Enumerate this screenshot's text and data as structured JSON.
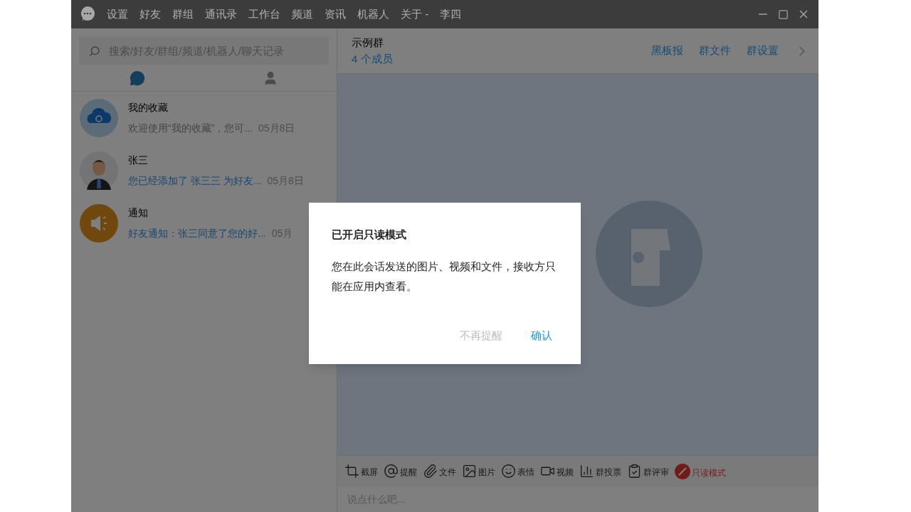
{
  "menu": [
    "设置",
    "好友",
    "群组",
    "通讯录",
    "工作台",
    "频道",
    "资讯",
    "机器人",
    "关于 -"
  ],
  "user": "李四",
  "search": {
    "placeholder": "搜索/好友/群组/频道/机器人/聊天记录"
  },
  "tabs": [
    {
      "kind": "chat",
      "selected": true
    },
    {
      "kind": "contacts",
      "selected": false
    }
  ],
  "conversations": [
    {
      "kind": "cloud",
      "name": "我的收藏",
      "preview": "欢迎使用“我的收藏”，您可...",
      "date": "05月8日",
      "highlighted": false
    },
    {
      "kind": "person",
      "name": "张三",
      "preview": "您已经添加了 张三三  为好友...",
      "date": "05月8日",
      "highlighted": true
    },
    {
      "kind": "speaker",
      "name": "通知",
      "preview": "好友通知：张三同意了您的好...",
      "date": "05月",
      "highlighted": true
    }
  ],
  "chat": {
    "title": "示例群",
    "members": "4 个成员",
    "actions": [
      "黑板报",
      "群文件",
      "群设置"
    ]
  },
  "toolbar": [
    {
      "kind": "crop",
      "label": "截屏",
      "active": false
    },
    {
      "kind": "at",
      "label": "提醒",
      "active": false
    },
    {
      "kind": "clip",
      "label": "文件",
      "active": false
    },
    {
      "kind": "image",
      "label": "图片",
      "active": false
    },
    {
      "kind": "smile",
      "label": "表情",
      "active": false
    },
    {
      "kind": "video",
      "label": "视频",
      "active": false
    },
    {
      "kind": "chart",
      "label": "群投票",
      "active": false
    },
    {
      "kind": "review",
      "label": "群评审",
      "active": false
    },
    {
      "kind": "readonly",
      "label": "只读模式",
      "active": true
    }
  ],
  "input": {
    "placeholder": "说点什么吧..."
  },
  "dialog": {
    "title": "已开启只读模式",
    "message": "您在此会话发送的图片、视频和文件，接收方只能在应用内查看。",
    "buttons": [
      {
        "kind": "secondary",
        "label": "不再提醒"
      },
      {
        "kind": "primary",
        "label": "确认"
      }
    ]
  }
}
